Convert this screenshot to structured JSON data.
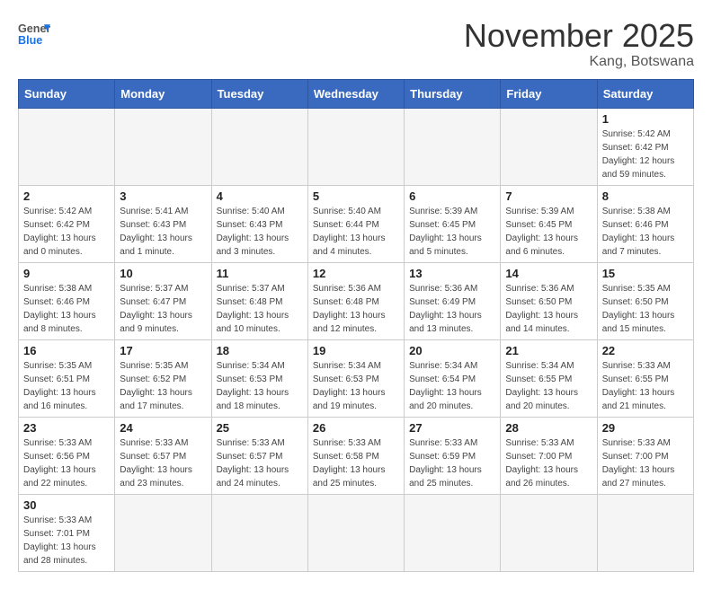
{
  "header": {
    "logo_general": "General",
    "logo_blue": "Blue",
    "month": "November 2025",
    "location": "Kang, Botswana"
  },
  "days_of_week": [
    "Sunday",
    "Monday",
    "Tuesday",
    "Wednesday",
    "Thursday",
    "Friday",
    "Saturday"
  ],
  "weeks": [
    [
      {
        "day": "",
        "info": ""
      },
      {
        "day": "",
        "info": ""
      },
      {
        "day": "",
        "info": ""
      },
      {
        "day": "",
        "info": ""
      },
      {
        "day": "",
        "info": ""
      },
      {
        "day": "",
        "info": ""
      },
      {
        "day": "1",
        "info": "Sunrise: 5:42 AM\nSunset: 6:42 PM\nDaylight: 12 hours\nand 59 minutes."
      }
    ],
    [
      {
        "day": "2",
        "info": "Sunrise: 5:42 AM\nSunset: 6:42 PM\nDaylight: 13 hours\nand 0 minutes."
      },
      {
        "day": "3",
        "info": "Sunrise: 5:41 AM\nSunset: 6:43 PM\nDaylight: 13 hours\nand 1 minute."
      },
      {
        "day": "4",
        "info": "Sunrise: 5:40 AM\nSunset: 6:43 PM\nDaylight: 13 hours\nand 3 minutes."
      },
      {
        "day": "5",
        "info": "Sunrise: 5:40 AM\nSunset: 6:44 PM\nDaylight: 13 hours\nand 4 minutes."
      },
      {
        "day": "6",
        "info": "Sunrise: 5:39 AM\nSunset: 6:45 PM\nDaylight: 13 hours\nand 5 minutes."
      },
      {
        "day": "7",
        "info": "Sunrise: 5:39 AM\nSunset: 6:45 PM\nDaylight: 13 hours\nand 6 minutes."
      },
      {
        "day": "8",
        "info": "Sunrise: 5:38 AM\nSunset: 6:46 PM\nDaylight: 13 hours\nand 7 minutes."
      }
    ],
    [
      {
        "day": "9",
        "info": "Sunrise: 5:38 AM\nSunset: 6:46 PM\nDaylight: 13 hours\nand 8 minutes."
      },
      {
        "day": "10",
        "info": "Sunrise: 5:37 AM\nSunset: 6:47 PM\nDaylight: 13 hours\nand 9 minutes."
      },
      {
        "day": "11",
        "info": "Sunrise: 5:37 AM\nSunset: 6:48 PM\nDaylight: 13 hours\nand 10 minutes."
      },
      {
        "day": "12",
        "info": "Sunrise: 5:36 AM\nSunset: 6:48 PM\nDaylight: 13 hours\nand 12 minutes."
      },
      {
        "day": "13",
        "info": "Sunrise: 5:36 AM\nSunset: 6:49 PM\nDaylight: 13 hours\nand 13 minutes."
      },
      {
        "day": "14",
        "info": "Sunrise: 5:36 AM\nSunset: 6:50 PM\nDaylight: 13 hours\nand 14 minutes."
      },
      {
        "day": "15",
        "info": "Sunrise: 5:35 AM\nSunset: 6:50 PM\nDaylight: 13 hours\nand 15 minutes."
      }
    ],
    [
      {
        "day": "16",
        "info": "Sunrise: 5:35 AM\nSunset: 6:51 PM\nDaylight: 13 hours\nand 16 minutes."
      },
      {
        "day": "17",
        "info": "Sunrise: 5:35 AM\nSunset: 6:52 PM\nDaylight: 13 hours\nand 17 minutes."
      },
      {
        "day": "18",
        "info": "Sunrise: 5:34 AM\nSunset: 6:53 PM\nDaylight: 13 hours\nand 18 minutes."
      },
      {
        "day": "19",
        "info": "Sunrise: 5:34 AM\nSunset: 6:53 PM\nDaylight: 13 hours\nand 19 minutes."
      },
      {
        "day": "20",
        "info": "Sunrise: 5:34 AM\nSunset: 6:54 PM\nDaylight: 13 hours\nand 20 minutes."
      },
      {
        "day": "21",
        "info": "Sunrise: 5:34 AM\nSunset: 6:55 PM\nDaylight: 13 hours\nand 20 minutes."
      },
      {
        "day": "22",
        "info": "Sunrise: 5:33 AM\nSunset: 6:55 PM\nDaylight: 13 hours\nand 21 minutes."
      }
    ],
    [
      {
        "day": "23",
        "info": "Sunrise: 5:33 AM\nSunset: 6:56 PM\nDaylight: 13 hours\nand 22 minutes."
      },
      {
        "day": "24",
        "info": "Sunrise: 5:33 AM\nSunset: 6:57 PM\nDaylight: 13 hours\nand 23 minutes."
      },
      {
        "day": "25",
        "info": "Sunrise: 5:33 AM\nSunset: 6:57 PM\nDaylight: 13 hours\nand 24 minutes."
      },
      {
        "day": "26",
        "info": "Sunrise: 5:33 AM\nSunset: 6:58 PM\nDaylight: 13 hours\nand 25 minutes."
      },
      {
        "day": "27",
        "info": "Sunrise: 5:33 AM\nSunset: 6:59 PM\nDaylight: 13 hours\nand 25 minutes."
      },
      {
        "day": "28",
        "info": "Sunrise: 5:33 AM\nSunset: 7:00 PM\nDaylight: 13 hours\nand 26 minutes."
      },
      {
        "day": "29",
        "info": "Sunrise: 5:33 AM\nSunset: 7:00 PM\nDaylight: 13 hours\nand 27 minutes."
      }
    ],
    [
      {
        "day": "30",
        "info": "Sunrise: 5:33 AM\nSunset: 7:01 PM\nDaylight: 13 hours\nand 28 minutes."
      },
      {
        "day": "",
        "info": ""
      },
      {
        "day": "",
        "info": ""
      },
      {
        "day": "",
        "info": ""
      },
      {
        "day": "",
        "info": ""
      },
      {
        "day": "",
        "info": ""
      },
      {
        "day": "",
        "info": ""
      }
    ]
  ]
}
